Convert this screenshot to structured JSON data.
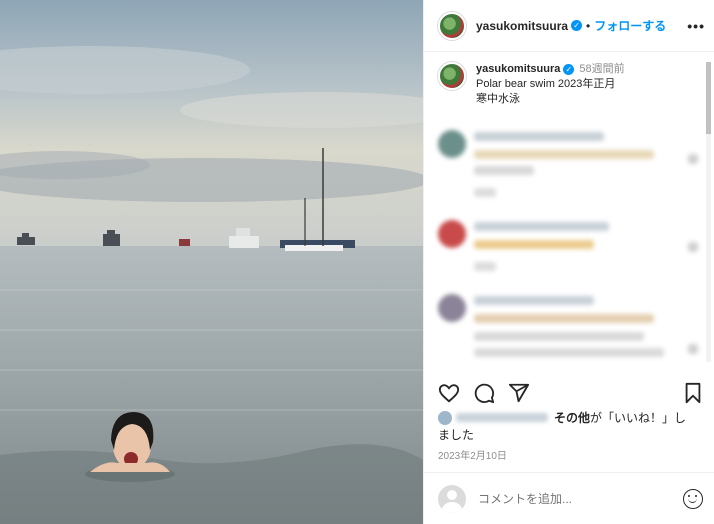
{
  "post": {
    "username": "yasukomitsuura",
    "verified": "✓",
    "dot": "•",
    "follow_label": "フォローする",
    "more": "•••"
  },
  "caption": {
    "username": "yasukomitsuura",
    "time": "58週間前",
    "line1": "Polar bear swim 2023年正月",
    "line2": "寒中水泳"
  },
  "likes": {
    "others_label": "その他",
    "liked_text_part1": "が「いいね！」し",
    "liked_text_part2": "ました"
  },
  "date": "2023年2月10日",
  "comment_input": {
    "placeholder": "コメントを追加..."
  },
  "icons": {
    "like": "heart-icon",
    "comment": "comment-icon",
    "share": "share-icon",
    "save": "bookmark-icon",
    "emoji": "emoji-icon",
    "more": "more-icon"
  },
  "colors": {
    "accent": "#0095f6",
    "text": "#262626",
    "muted": "#8e8e8e"
  }
}
